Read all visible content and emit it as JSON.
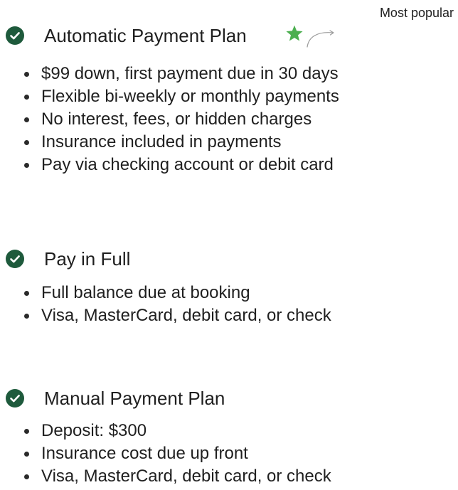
{
  "badge": {
    "label": "Most popular"
  },
  "plans": [
    {
      "title": "Automatic Payment Plan",
      "featured": true,
      "features": [
        "$99 down, first payment due in 30 days",
        "Flexible bi-weekly or monthly payments",
        "No interest, fees, or hidden charges",
        "Insurance included in payments",
        "Pay via checking account or debit card"
      ]
    },
    {
      "title": "Pay in Full",
      "featured": false,
      "features": [
        "Full balance due at booking",
        "Visa, MasterCard, debit card, or check"
      ]
    },
    {
      "title": "Manual Payment Plan",
      "featured": false,
      "features": [
        "Deposit: $300",
        "Insurance cost due up front",
        "Visa, MasterCard, debit card, or check"
      ]
    }
  ],
  "icons": {
    "check": "check-circle-icon",
    "star": "star-icon",
    "arrow": "curved-arrow-icon"
  },
  "colors": {
    "check_bg": "#1e5a3c",
    "check_mark": "#ffffff",
    "star": "#4caf50",
    "arrow": "#9a9a9a",
    "text": "#1f1f1f"
  }
}
